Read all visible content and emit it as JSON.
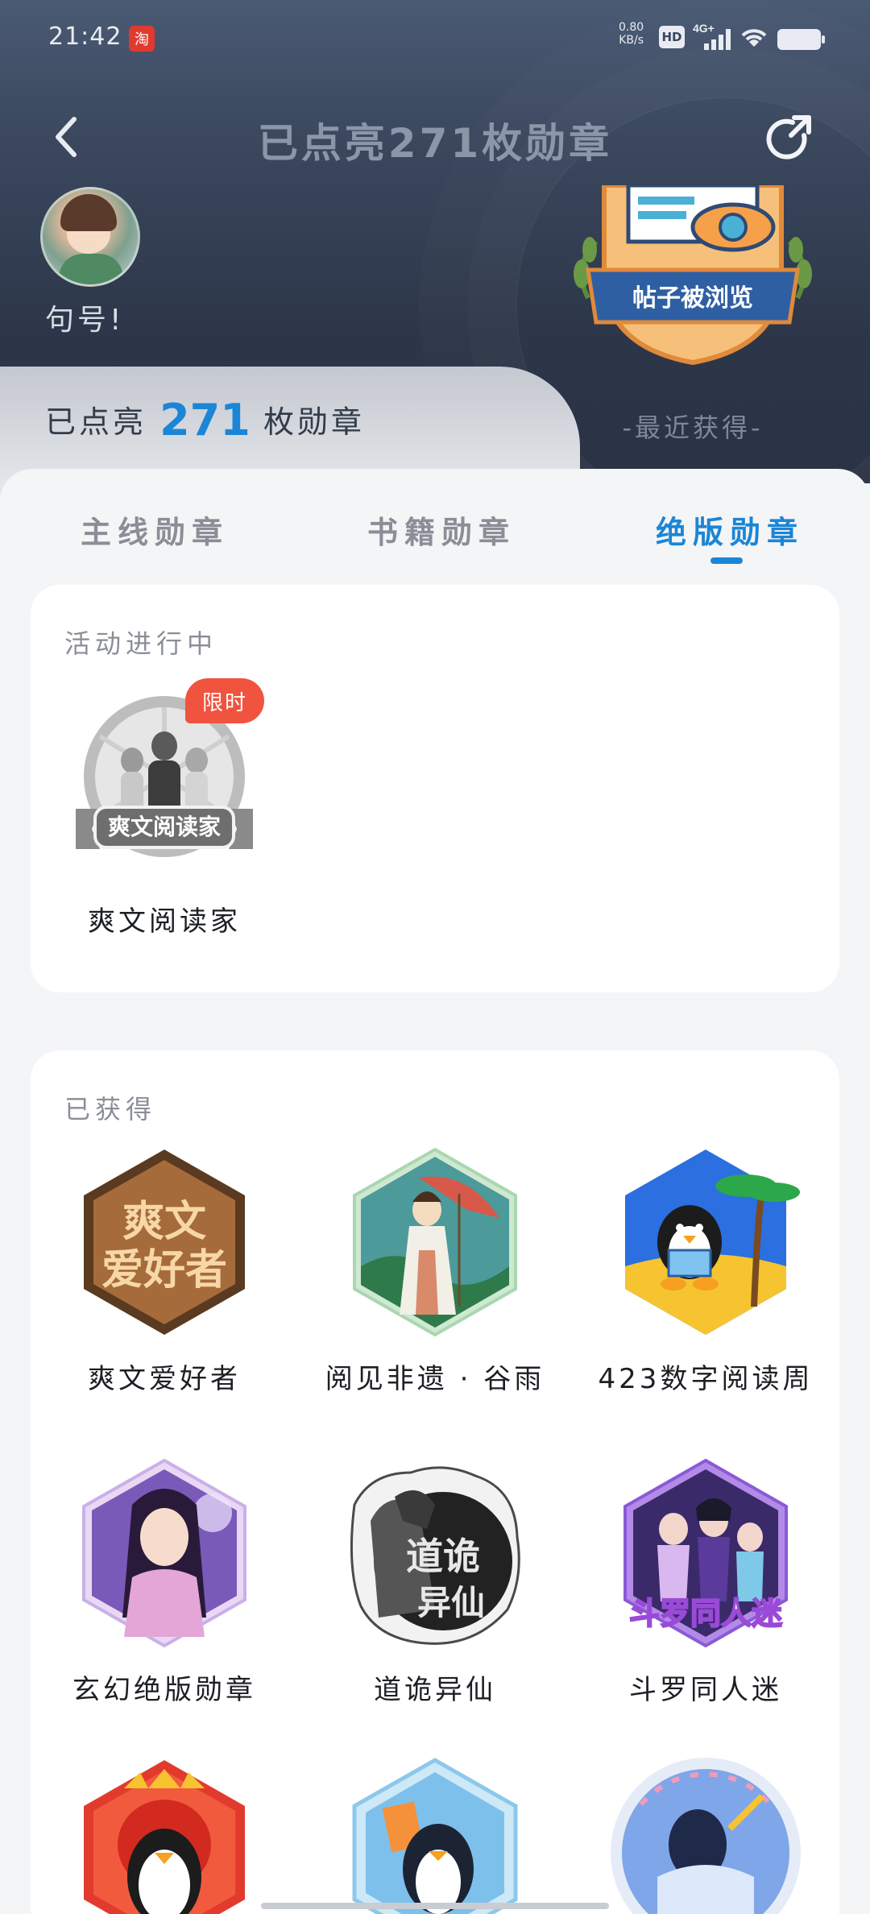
{
  "status_bar": {
    "time": "21:42",
    "app_icon": "淘",
    "net_speed": "0.80",
    "net_unit": "KB/s",
    "hd": "HD",
    "network": "4G+"
  },
  "nav": {
    "title": "已点亮271枚勋章"
  },
  "profile": {
    "username": "句号!"
  },
  "recent": {
    "badge_text": "帖子被浏览",
    "caption": "-最近获得-"
  },
  "lit": {
    "prefix": "已点亮",
    "count": "271",
    "suffix": "枚勋章"
  },
  "tabs": [
    {
      "label": "主线勋章"
    },
    {
      "label": "书籍勋章"
    },
    {
      "label": "绝版勋章",
      "active": true
    }
  ],
  "ongoing": {
    "title": "活动进行中",
    "badges": [
      {
        "label": "爽文阅读家",
        "ribbon": "爽文阅读家",
        "tag": "限时"
      }
    ]
  },
  "obtained": {
    "title": "已获得",
    "badges": [
      {
        "label": "爽文爱好者",
        "art_text_1": "爽文",
        "art_text_2": "爱好者"
      },
      {
        "label": "阅见非遗 · 谷雨"
      },
      {
        "label": "423数字阅读周"
      },
      {
        "label": "玄幻绝版勋章"
      },
      {
        "label": "道诡异仙",
        "art_text_1": "道诡",
        "art_text_2": "异仙"
      },
      {
        "label": "斗罗同人迷",
        "art_text_1": "斗罗同人迷"
      }
    ]
  },
  "colors": {
    "accent": "#1b86d6",
    "tag_red": "#f0533e",
    "hero_dark": "#2c3648"
  }
}
